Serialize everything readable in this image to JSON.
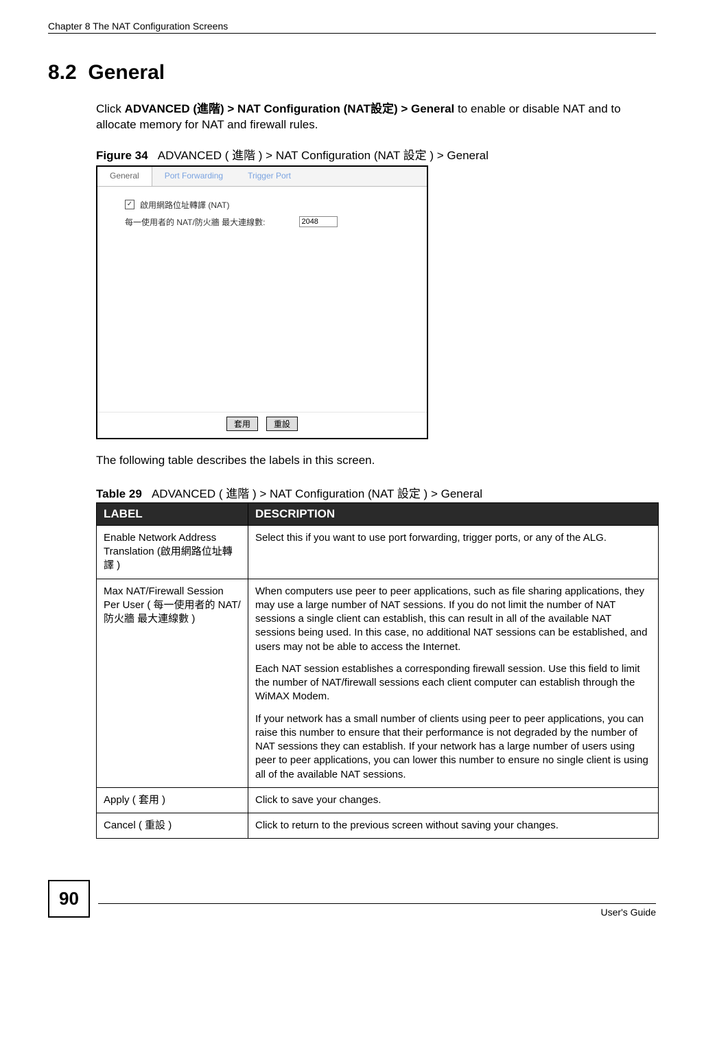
{
  "runningHeader": "Chapter 8 The NAT Configuration Screens",
  "section": {
    "number": "8.2",
    "title": "General"
  },
  "intro": {
    "pre": "Click ",
    "b1": "ADVANCED (進階) > NAT Configuration  (NAT設定) > General",
    "post": " to enable or disable NAT and to allocate memory for NAT and firewall rules."
  },
  "figure": {
    "label": "Figure 34",
    "caption": "ADVANCED ( 進階 ) > NAT Configuration (NAT 設定 ) > General",
    "tabs": [
      "General",
      "Port Forwarding",
      "Trigger Port"
    ],
    "checkboxLabel": "啟用網路位址轉譯 (NAT)",
    "sessLabel": "每一使用者的 NAT/防火牆 最大連線數:",
    "sessValue": "2048",
    "applyBtn": "套用",
    "resetBtn": "重設"
  },
  "postFigureText": "The following table describes the labels in this screen.",
  "table": {
    "label": "Table 29",
    "caption": "ADVANCED ( 進階 )  > NAT Configuration (NAT 設定 ) > General",
    "headers": {
      "label": "LABEL",
      "description": "DESCRIPTION"
    },
    "rows": [
      {
        "label": "Enable Network Address Translation (啟用網路位址轉譯 )",
        "desc": "Select this if you want to use port forwarding, trigger ports, or any of the ALG."
      },
      {
        "label": "Max NAT/Firewall Session Per User ( 每一使用者的 NAT/ 防火牆 最大連線數 )",
        "descParas": [
          "When computers use peer to peer applications, such as file sharing applications, they may use a large number of NAT sessions. If you do not limit the number of NAT sessions a single client can establish, this can result in all of the available NAT sessions being used. In this case, no additional NAT sessions can be established, and users may not be able to access the Internet.",
          "Each NAT session establishes a corresponding firewall session. Use this field to limit the number of NAT/firewall sessions each client computer can establish through the WiMAX Modem.",
          "If your network has a small number of clients using peer to peer applications, you can raise this number to ensure that their performance is not degraded by the number of NAT sessions they can establish. If your network has a large number of users using peer to peer applications, you can lower this number to ensure no single client is using all of the available NAT sessions."
        ]
      },
      {
        "label": "Apply ( 套用 )",
        "desc": "Click to save your changes."
      },
      {
        "label": "Cancel ( 重設 )",
        "desc": "Click to return to the previous screen without saving your changes."
      }
    ]
  },
  "footer": {
    "pageNumber": "90",
    "guide": "User's Guide"
  }
}
